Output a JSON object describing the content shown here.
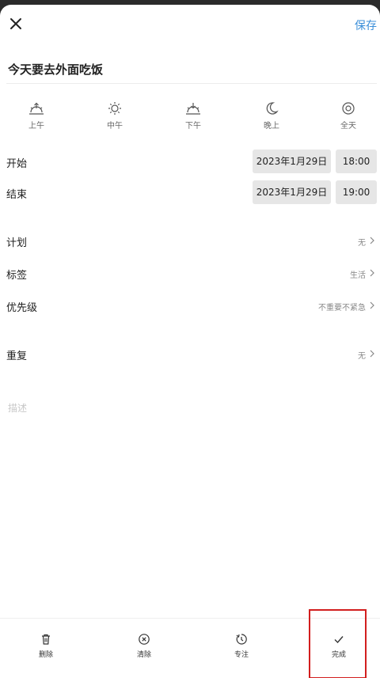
{
  "header": {
    "save_label": "保存",
    "close_icon": "close-icon"
  },
  "task": {
    "title": "今天要去外面吃饭"
  },
  "periods": [
    {
      "label": "上午",
      "icon": "sunrise-icon"
    },
    {
      "label": "中午",
      "icon": "sun-icon"
    },
    {
      "label": "下午",
      "icon": "sunset-icon"
    },
    {
      "label": "晚上",
      "icon": "moon-icon"
    },
    {
      "label": "全天",
      "icon": "all-day-icon"
    }
  ],
  "schedule": {
    "start": {
      "label": "开始",
      "date": "2023年1月29日",
      "time": "18:00"
    },
    "end": {
      "label": "结束",
      "date": "2023年1月29日",
      "time": "19:00"
    }
  },
  "settings": {
    "plan": {
      "label": "计划",
      "value": "无"
    },
    "tag": {
      "label": "标签",
      "value": "生活"
    },
    "priority": {
      "label": "优先级",
      "value": "不重要不紧急"
    },
    "repeat": {
      "label": "重复",
      "value": "无"
    }
  },
  "description": {
    "placeholder": "描述"
  },
  "bottom_bar": {
    "delete": {
      "label": "删除",
      "icon": "trash-icon"
    },
    "clear": {
      "label": "清除",
      "icon": "clear-circle-icon"
    },
    "focus": {
      "label": "专注",
      "icon": "timer-icon"
    },
    "complete": {
      "label": "完成",
      "icon": "check-icon"
    }
  },
  "colors": {
    "accent": "#3b8fd9",
    "highlight": "#d21e1e",
    "chip_bg": "#e6e6e6"
  }
}
